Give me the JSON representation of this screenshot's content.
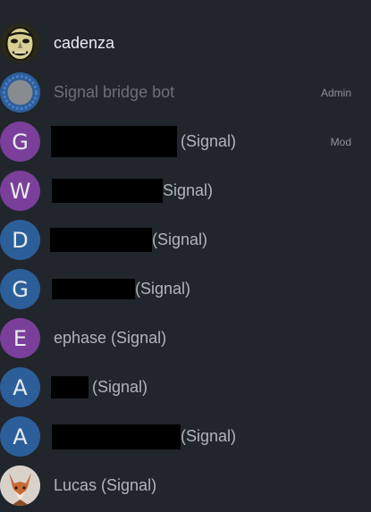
{
  "members": [
    {
      "name": "cadenza",
      "avatar_kind": "image",
      "avatar_icon": "mask-face-icon",
      "variant": "self"
    },
    {
      "name": "Signal bridge bot",
      "avatar_kind": "image",
      "avatar_icon": "bot-avatar-icon",
      "variant": "dim",
      "role": "Admin"
    },
    {
      "letter": "G",
      "avatar_color": "#7a3f9a",
      "suffix": "(Signal)",
      "role": "Mod"
    },
    {
      "letter": "W",
      "avatar_color": "#7a3f9a",
      "suffix": "Signal)"
    },
    {
      "letter": "D",
      "avatar_color": "#2c5f9a",
      "suffix": "(Signal)"
    },
    {
      "letter": "G",
      "avatar_color": "#2c5f9a",
      "suffix": "(Signal)"
    },
    {
      "letter": "E",
      "avatar_color": "#7a3f9a",
      "name": "ephase (Signal)"
    },
    {
      "letter": "A",
      "avatar_color": "#2c5f9a",
      "suffix": "(Signal)"
    },
    {
      "letter": "A",
      "avatar_color": "#2c5f9a",
      "suffix": "(Signal)"
    },
    {
      "name": "Lucas (Signal)",
      "avatar_kind": "image",
      "avatar_icon": "fox-icon"
    }
  ]
}
